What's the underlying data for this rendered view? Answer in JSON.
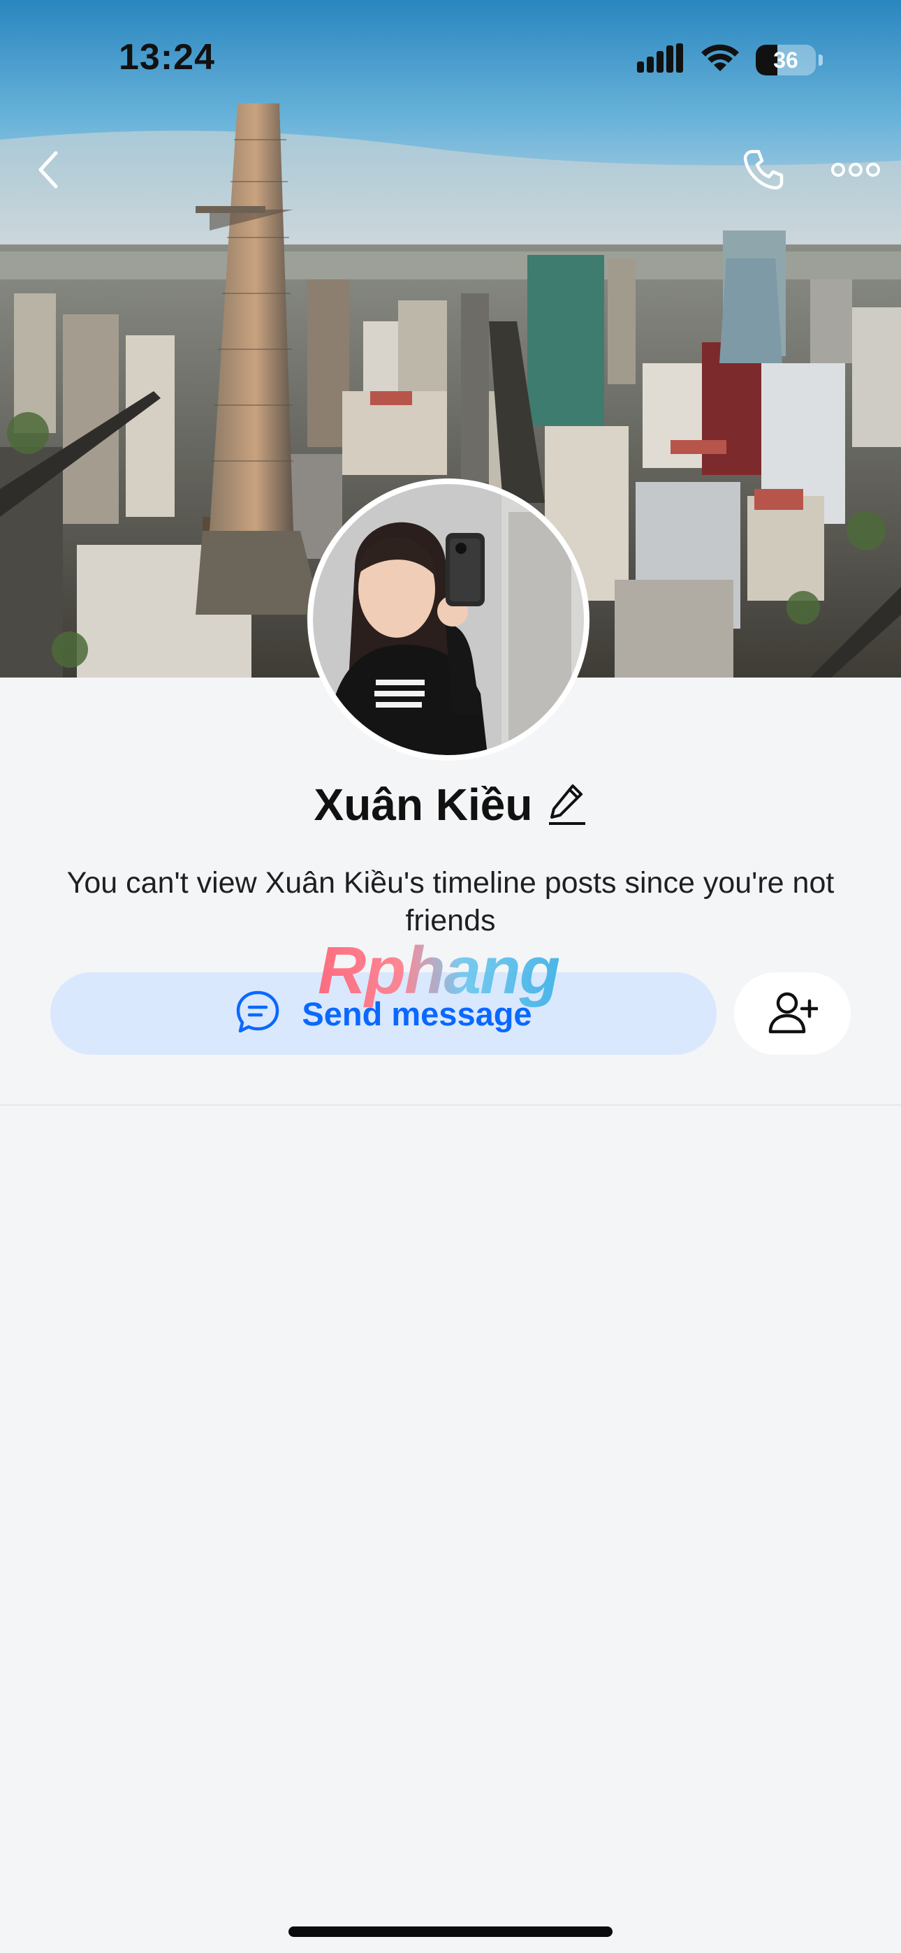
{
  "status_bar": {
    "time": "13:24",
    "battery_level": "36",
    "icons": [
      "signal-icon",
      "wifi-icon",
      "battery-icon"
    ]
  },
  "nav": {
    "icons": [
      "back-chevron-icon",
      "phone-icon",
      "more-icon"
    ]
  },
  "profile": {
    "name": "Xuân Kiều",
    "notice": "You can't view Xuân Kiều's timeline posts since you're not friends"
  },
  "actions": {
    "send_message_label": "Send message",
    "send_message_icon": "chat-bubble-icon",
    "add_friend_icon": "add-friend-icon"
  },
  "watermark": {
    "text": "Rphang"
  },
  "colors": {
    "accent": "#0a68ff",
    "send_button_bg": "#d9e8fd",
    "page_bg": "#f4f5f7"
  }
}
